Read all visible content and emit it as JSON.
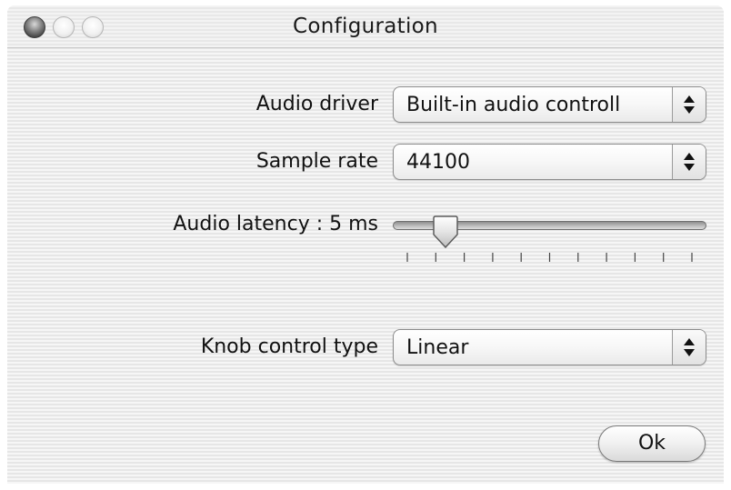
{
  "window": {
    "title": "Configuration"
  },
  "title_buttons": {
    "close": "close-button",
    "minimize": "minimize-button",
    "zoom": "zoom-button"
  },
  "form": {
    "audio_driver": {
      "label": "Audio driver",
      "value": "Built-in audio controll"
    },
    "sample_rate": {
      "label": "Sample rate",
      "value": "44100"
    },
    "audio_latency": {
      "label": "Audio latency : 5 ms",
      "value_ms": 5,
      "thumb_fraction": 0.133,
      "tick_count": 11
    },
    "knob_control_type": {
      "label": "Knob control type",
      "value": "Linear"
    }
  },
  "buttons": {
    "ok_label": "Ok"
  },
  "icons": {
    "popup_arrows": "up-down-arrows-icon"
  }
}
